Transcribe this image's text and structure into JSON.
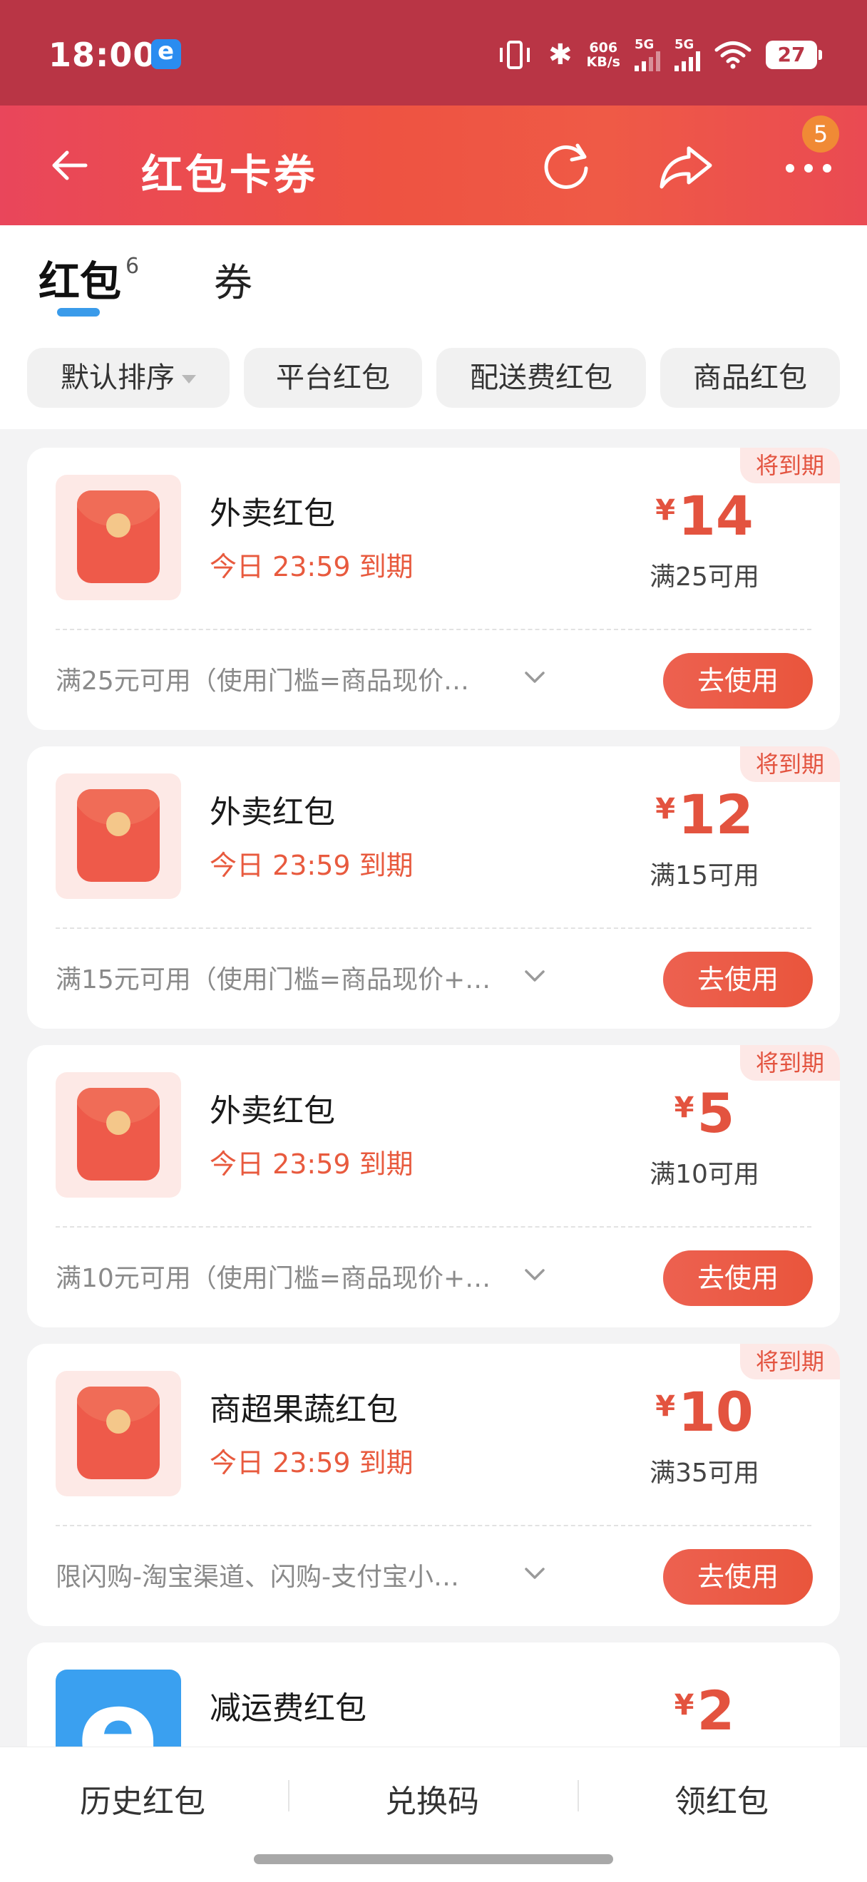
{
  "status_bar": {
    "time": "18:00",
    "speed_value": "606",
    "speed_unit": "KB/s",
    "signal1": "5G",
    "signal2": "5G",
    "battery": "27"
  },
  "header": {
    "title": "红包卡券",
    "badge": "5"
  },
  "tabs": {
    "hongbao": "红包",
    "hongbao_count": "6",
    "quan": "券"
  },
  "filters": [
    {
      "label": "默认排序"
    },
    {
      "label": "平台红包"
    },
    {
      "label": "配送费红包"
    },
    {
      "label": "商品红包"
    }
  ],
  "cards": [
    {
      "tag": "将到期",
      "title": "外卖红包",
      "expiry": "今日 23:59 到期",
      "currency": "¥",
      "amount": "14",
      "condition": "满25可用",
      "rule": "满25元可用（使用门槛=商品现价…",
      "button": "去使用"
    },
    {
      "tag": "将到期",
      "title": "外卖红包",
      "expiry": "今日 23:59 到期",
      "currency": "¥",
      "amount": "12",
      "condition": "满15可用",
      "rule": "满15元可用（使用门槛=商品现价+…",
      "button": "去使用"
    },
    {
      "tag": "将到期",
      "title": "外卖红包",
      "expiry": "今日 23:59 到期",
      "currency": "¥",
      "amount": "5",
      "condition": "满10可用",
      "rule": "满10元可用（使用门槛=商品现价+…",
      "button": "去使用"
    },
    {
      "tag": "将到期",
      "title": "商超果蔬红包",
      "expiry": "今日 23:59 到期",
      "currency": "¥",
      "amount": "10",
      "condition": "满35可用",
      "rule": "限闪购-淘宝渠道、闪购-支付宝小…",
      "button": "去使用"
    },
    {
      "title": "减运费红包",
      "currency": "¥",
      "amount": "2"
    }
  ],
  "bottom_bar": {
    "history": "历史红包",
    "redeem": "兑换码",
    "claim": "领红包"
  },
  "colors": {
    "accent": "#e3533f",
    "header_start": "#e9465b",
    "header_end": "#ef5a46",
    "status_bar": "#b93545",
    "tab_indicator": "#3a9bea"
  }
}
